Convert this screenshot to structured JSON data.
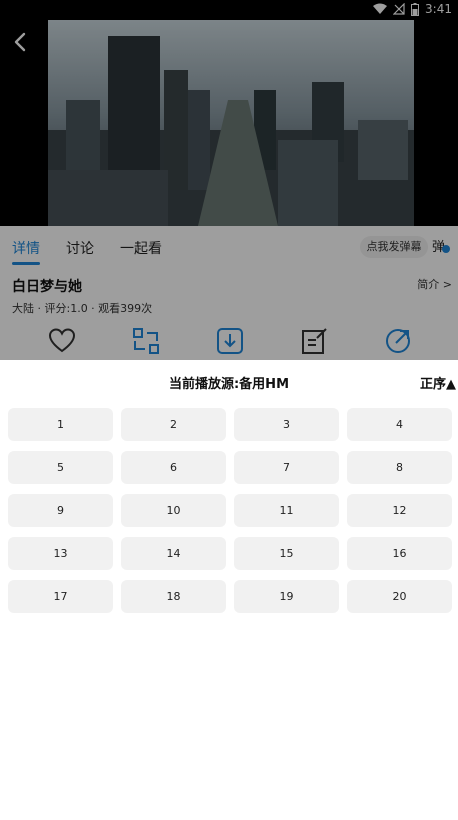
{
  "status": {
    "time": "3:41"
  },
  "video": {},
  "tabs": [
    {
      "label": "详情"
    },
    {
      "label": "讨论"
    },
    {
      "label": "一起看"
    }
  ],
  "danmaku": {
    "button_label": "点我发弹幕",
    "toggle_label": "弹"
  },
  "info": {
    "title": "白日梦与她",
    "intro_label": "简介 >",
    "meta": "大陆 · 评分:1.0 · 观看399次"
  },
  "actions": [
    {
      "icon": "heart-icon"
    },
    {
      "icon": "switch-source-icon"
    },
    {
      "icon": "download-icon"
    },
    {
      "icon": "edit-icon"
    },
    {
      "icon": "share-icon"
    }
  ],
  "sheet": {
    "title": "当前播放源:备用HM",
    "order_label": "正序▲",
    "episodes": [
      "1",
      "2",
      "3",
      "4",
      "5",
      "6",
      "7",
      "8",
      "9",
      "10",
      "11",
      "12",
      "13",
      "14",
      "15",
      "16",
      "17",
      "18",
      "19",
      "20"
    ]
  }
}
